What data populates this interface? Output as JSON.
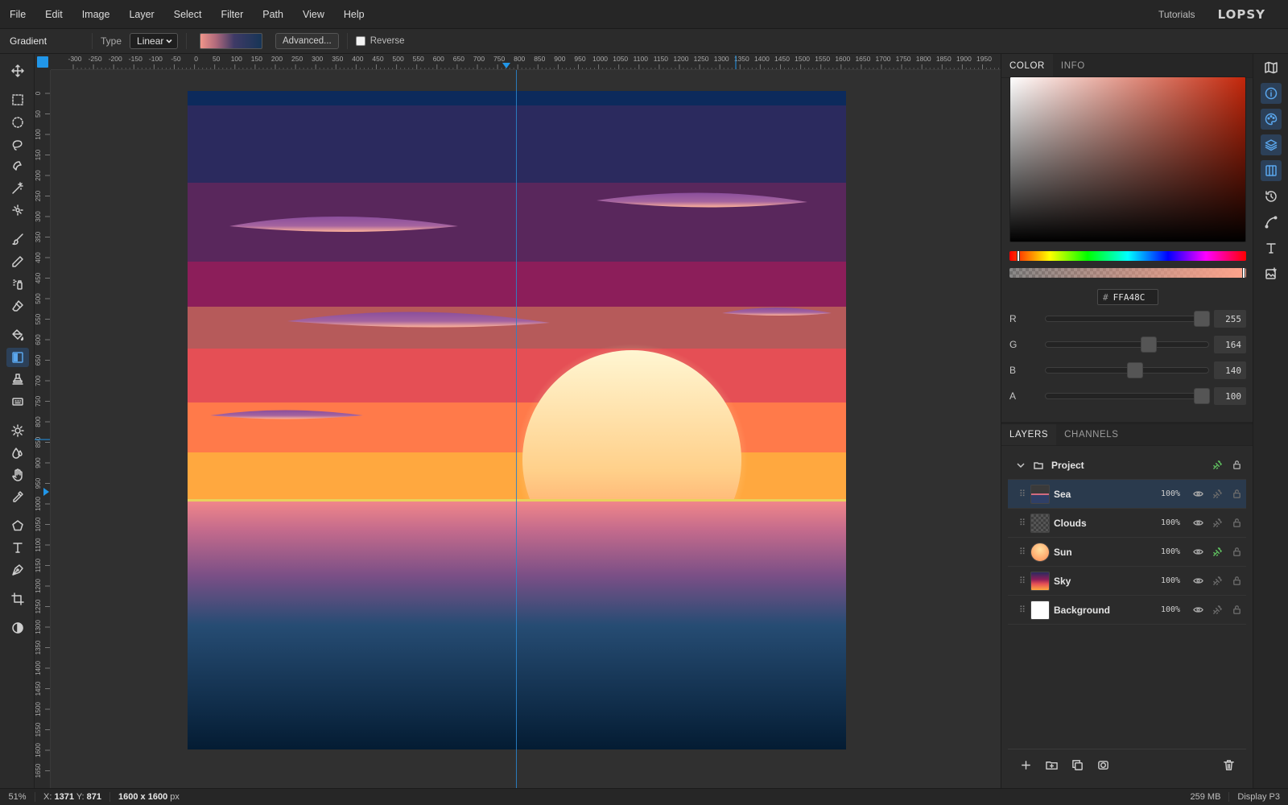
{
  "menu": {
    "items": [
      "File",
      "Edit",
      "Image",
      "Layer",
      "Select",
      "Filter",
      "Path",
      "View",
      "Help"
    ],
    "tutorials": "Tutorials",
    "logo": "LOPSY"
  },
  "options": {
    "tool_title": "Gradient",
    "type_label": "Type",
    "type_value": "Linear",
    "advanced_label": "Advanced...",
    "reverse_label": "Reverse",
    "reverse_checked": false
  },
  "ruler": {
    "top_labels": [
      "-300",
      "-250",
      "-200",
      "-150",
      "-100",
      "-50",
      "0",
      "50",
      "100",
      "150",
      "200",
      "250",
      "300",
      "350",
      "400",
      "450",
      "500",
      "550",
      "600",
      "650",
      "700",
      "750",
      "800",
      "850",
      "900",
      "950",
      "1000",
      "1050",
      "1100",
      "1150",
      "1200",
      "1250",
      "1300",
      "1350",
      "1400",
      "1450",
      "1500",
      "1550",
      "1600",
      "1650",
      "1700",
      "1750",
      "1800",
      "1850",
      "1900",
      "1950"
    ],
    "left_labels": [
      "0",
      "50",
      "100",
      "150",
      "200",
      "250",
      "300",
      "350",
      "400",
      "450",
      "500",
      "550",
      "600",
      "650",
      "700",
      "750",
      "800",
      "850",
      "900",
      "950",
      "1000",
      "1050",
      "1100",
      "1150",
      "1200",
      "1250",
      "1300",
      "1350",
      "1400",
      "1450",
      "1500",
      "1550",
      "1600",
      "1650"
    ]
  },
  "color_panel": {
    "tabs": [
      "COLOR",
      "INFO"
    ],
    "active_tab": "COLOR",
    "hex": "FFA48C",
    "hex_prefix": "#",
    "channels": [
      {
        "label": "R",
        "value": "255",
        "level": 1.0
      },
      {
        "label": "G",
        "value": "164",
        "level": 0.643
      },
      {
        "label": "B",
        "value": "140",
        "level": 0.549
      },
      {
        "label": "A",
        "value": "100",
        "level": 1.0
      }
    ],
    "field_hue_color": "#c3260a",
    "current_color": "#FFA48C"
  },
  "layers_panel": {
    "tabs": [
      "LAYERS",
      "CHANNELS"
    ],
    "active_tab": "LAYERS",
    "group": {
      "name": "Project"
    },
    "layers": [
      {
        "name": "Sea",
        "opacity": "100%",
        "selected": true,
        "thumb": "sea"
      },
      {
        "name": "Clouds",
        "opacity": "100%",
        "selected": false,
        "thumb": "clouds"
      },
      {
        "name": "Sun",
        "opacity": "100%",
        "selected": false,
        "thumb": "sun"
      },
      {
        "name": "Sky",
        "opacity": "100%",
        "selected": false,
        "thumb": "sky"
      },
      {
        "name": "Background",
        "opacity": "100%",
        "selected": false,
        "thumb": "background"
      }
    ]
  },
  "status": {
    "zoom": "51%",
    "x_label": "X:",
    "x_value": "1371",
    "y_label": "Y:",
    "y_value": "871",
    "dims_value": "1600 x 1600",
    "dims_unit": "px",
    "memory": "259 MB",
    "profile": "Display P3"
  },
  "tools": [
    "move-icon",
    "rect-select-icon",
    "ellipse-select-icon",
    "lasso-icon",
    "magnetic-lasso-icon",
    "magic-wand-icon",
    "quick-select-icon",
    "brush-icon",
    "pencil-icon",
    "spray-icon",
    "eraser-icon",
    "bucket-icon",
    "gradient-icon",
    "stamp-icon",
    "patch-icon",
    "dodge-icon",
    "blur-icon",
    "smudge-icon",
    "eyedropper-icon",
    "polygon-icon",
    "text-icon",
    "pen-icon",
    "crop-icon",
    "contrast-icon"
  ],
  "active_tool": "gradient-icon",
  "side_icons": [
    "map-icon",
    "info-icon",
    "palette-icon",
    "layers-icon",
    "columns-icon",
    "history-icon",
    "curve-icon",
    "text-icon",
    "image-add-icon"
  ]
}
